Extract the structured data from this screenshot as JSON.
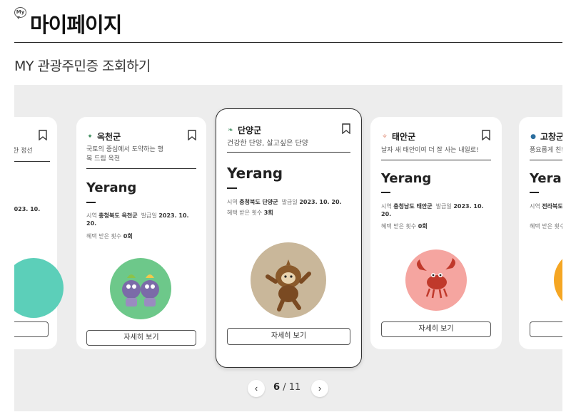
{
  "page": {
    "badge": "My",
    "title": "마이페이지",
    "section_title": "MY 관광주민증 조회하기"
  },
  "labels": {
    "region": "시역",
    "issued": "발급일",
    "benefit": "혜택 받은 횟수",
    "detail_button": "자세히 보기"
  },
  "cards": [
    {
      "region": "",
      "slogan": "한 정선",
      "name": "",
      "location": "",
      "issued": "2023. 10.",
      "benefit": "",
      "mascot_color": "#5ccfb9"
    },
    {
      "region": "옥천군",
      "slogan": "국토의 중심에서 도약하는 행복 드림 옥천",
      "name": "Yerang",
      "location": "충청북도 옥천군",
      "issued": "2023. 10. 20.",
      "benefit": "0회",
      "mascot_color": "#6dc88a"
    },
    {
      "region": "단양군",
      "slogan": "건강한 단양, 살고싶은 단양",
      "name": "Yerang",
      "location": "충청북도 단양군",
      "issued": "2023. 10. 20.",
      "benefit": "3회",
      "mascot_color": "#c9b79a"
    },
    {
      "region": "태안군",
      "slogan": "날자 새 태안이여 더 잘 사는 내일로!",
      "name": "Yerang",
      "location": "충청남도 태안군",
      "issued": "2023. 10. 20.",
      "benefit": "0회",
      "mascot_color": "#f5a5a0"
    },
    {
      "region": "고창군",
      "slogan": "풍요롭게 친환",
      "name": "Yerang",
      "location": "전라북도",
      "issued": "",
      "benefit": "",
      "mascot_color": "#f5a623"
    }
  ],
  "pager": {
    "prev_icon": "chevron-left-icon",
    "next_icon": "chevron-right-icon",
    "current": "6",
    "separator": "/",
    "total": "11"
  }
}
